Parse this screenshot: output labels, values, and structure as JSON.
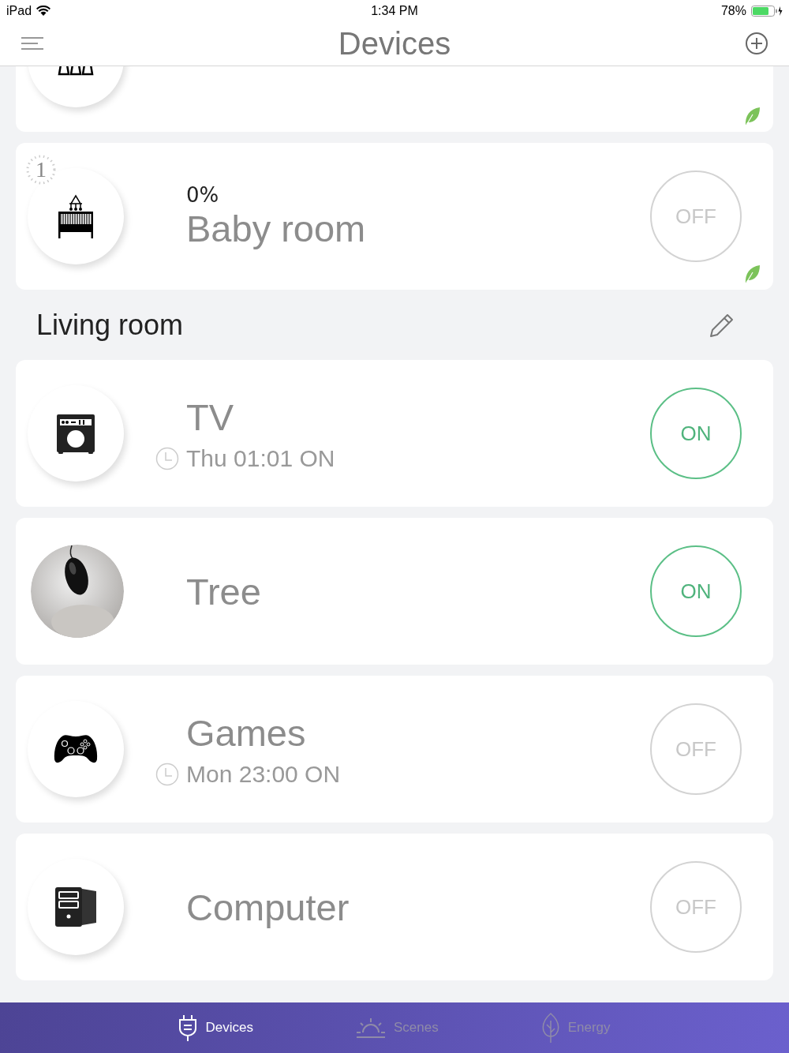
{
  "status_bar": {
    "carrier": "iPad",
    "time": "1:34 PM",
    "battery": "78%"
  },
  "header": {
    "title": "Devices"
  },
  "partial_card": {
    "kind": "lamps",
    "eco": true
  },
  "rooms": [
    {
      "timer": "1",
      "percent": "0%",
      "name": "Baby room",
      "kind": "crib",
      "switch_label": "OFF",
      "on": false,
      "eco": true
    }
  ],
  "section": {
    "title": "Living room"
  },
  "devices": [
    {
      "name": "TV",
      "kind": "amplifier",
      "schedule": "Thu 01:01 ON",
      "switch_label": "ON",
      "on": true
    },
    {
      "name": "Tree",
      "kind": "picture",
      "switch_label": "ON",
      "on": true
    },
    {
      "name": "Games",
      "kind": "gamepad",
      "schedule": "Mon 23:00 ON",
      "switch_label": "OFF",
      "on": false
    },
    {
      "name": "Computer",
      "kind": "computer",
      "switch_label": "OFF",
      "on": false
    }
  ],
  "tabs": [
    {
      "label": "Devices",
      "kind": "plug",
      "selected": true
    },
    {
      "label": "Scenes",
      "kind": "sunrise",
      "selected": false
    },
    {
      "label": "Energy",
      "kind": "leaf",
      "selected": false
    }
  ]
}
